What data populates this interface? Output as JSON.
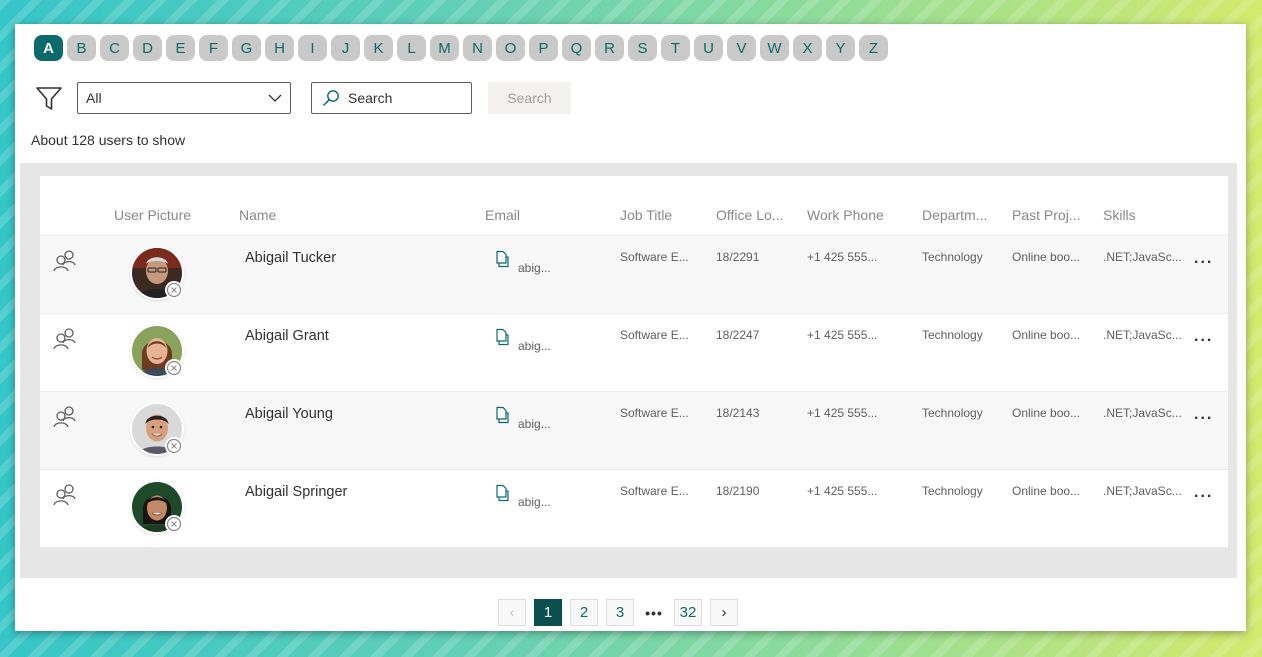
{
  "alphabet": {
    "letters": [
      "A",
      "B",
      "C",
      "D",
      "E",
      "F",
      "G",
      "H",
      "I",
      "J",
      "K",
      "L",
      "M",
      "N",
      "O",
      "P",
      "Q",
      "R",
      "S",
      "T",
      "U",
      "V",
      "W",
      "X",
      "Y",
      "Z"
    ],
    "active": "A"
  },
  "filter": {
    "dropdown_value": "All",
    "search_placeholder": "Search",
    "search_button_label": "Search"
  },
  "user_count_text": "About 128 users to show",
  "table": {
    "headers": {
      "picture": "User Picture",
      "name": "Name",
      "email": "Email",
      "job_title": "Job Title",
      "office": "Office Lo...",
      "work_phone": "Work Phone",
      "department": "Departm...",
      "past_projects": "Past Proj...",
      "skills": "Skills"
    },
    "rows": [
      {
        "name": "Abigail Tucker",
        "email": "abig...",
        "job_title": "Software E...",
        "office": "18/2291",
        "work_phone": "+1 425 555...",
        "department": "Technology",
        "past_projects": "Online boo...",
        "skills": ".NET;JavaSc..."
      },
      {
        "name": "Abigail Grant",
        "email": "abig...",
        "job_title": "Software E...",
        "office": "18/2247",
        "work_phone": "+1 425 555...",
        "department": "Technology",
        "past_projects": "Online boo...",
        "skills": ".NET;JavaSc..."
      },
      {
        "name": "Abigail Young",
        "email": "abig...",
        "job_title": "Software E...",
        "office": "18/2143",
        "work_phone": "+1 425 555...",
        "department": "Technology",
        "past_projects": "Online boo...",
        "skills": ".NET;JavaSc..."
      },
      {
        "name": "Abigail Springer",
        "email": "abig...",
        "job_title": "Software E...",
        "office": "18/2190",
        "work_phone": "+1 425 555...",
        "department": "Technology",
        "past_projects": "Online boo...",
        "skills": ".NET;JavaSc..."
      }
    ],
    "more_label": "..."
  },
  "pagination": {
    "prev": "‹",
    "pages": [
      "1",
      "2",
      "3"
    ],
    "ellipsis": "•••",
    "last": "32",
    "next": "›",
    "current": "1"
  },
  "icons": {
    "filter": "filter-icon",
    "dropdown": "chevron-down-icon",
    "search": "search-icon",
    "row_action": "people-icon",
    "email_copy": "copy-icon",
    "presence": "presence-offline-icon",
    "more": "more-icon"
  },
  "colors": {
    "accent": "#0b6a6a",
    "letter_bg": "#c9c9c9",
    "pager_active": "#0b4f4f"
  }
}
